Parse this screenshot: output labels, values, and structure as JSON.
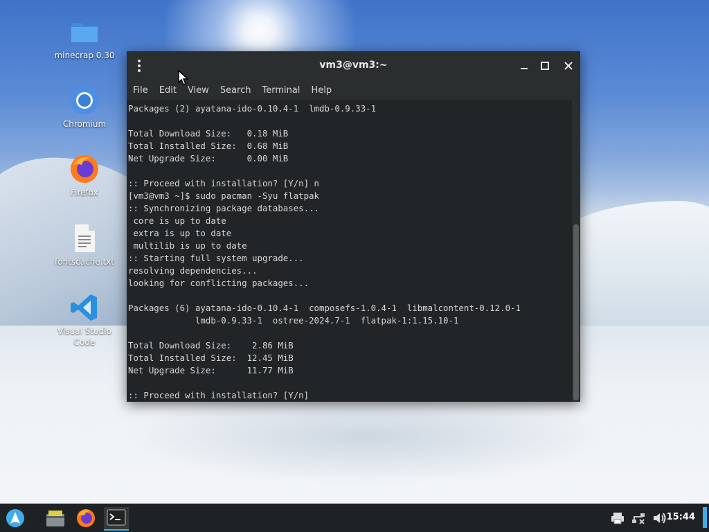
{
  "desktop": {
    "icons": [
      {
        "label": "minecrap 0.30",
        "icon": "folder-icon"
      },
      {
        "label": "Chromium",
        "icon": "chromium-icon"
      },
      {
        "label": "Firefox",
        "icon": "firefox-icon"
      },
      {
        "label": "fontscache.txt",
        "icon": "text-file-icon"
      },
      {
        "label": "Visual Studio Code",
        "icon": "vscode-icon"
      }
    ]
  },
  "terminal": {
    "title": "vm3@vm3:~",
    "menu": [
      "File",
      "Edit",
      "View",
      "Search",
      "Terminal",
      "Help"
    ],
    "lines": [
      "Packages (2) ayatana-ido-0.10.4-1  lmdb-0.9.33-1",
      "",
      "Total Download Size:   0.18 MiB",
      "Total Installed Size:  0.68 MiB",
      "Net Upgrade Size:      0.00 MiB",
      "",
      ":: Proceed with installation? [Y/n] n",
      "[vm3@vm3 ~]$ sudo pacman -Syu flatpak",
      ":: Synchronizing package databases...",
      " core is up to date",
      " extra is up to date",
      " multilib is up to date",
      ":: Starting full system upgrade...",
      "resolving dependencies...",
      "looking for conflicting packages...",
      "",
      "Packages (6) ayatana-ido-0.10.4-1  composefs-1.0.4-1  libmalcontent-0.12.0-1",
      "             lmdb-0.9.33-1  ostree-2024.7-1  flatpak-1:1.15.10-1",
      "",
      "Total Download Size:    2.86 MiB",
      "Total Installed Size:  12.45 MiB",
      "Net Upgrade Size:      11.77 MiB",
      "",
      ":: Proceed with installation? [Y/n]"
    ]
  },
  "taskbar": {
    "launcher_icon": "arch-logo-icon",
    "pinned": [
      "file-manager-icon",
      "firefox-icon",
      "terminal-icon"
    ],
    "tray": [
      "printer-icon",
      "network-icon",
      "volume-icon"
    ],
    "clock": "15:44"
  },
  "colors": {
    "accent": "#3daee9",
    "terminal_bg": "#2b2e2f",
    "terminal_text": "#d7d7d7"
  }
}
